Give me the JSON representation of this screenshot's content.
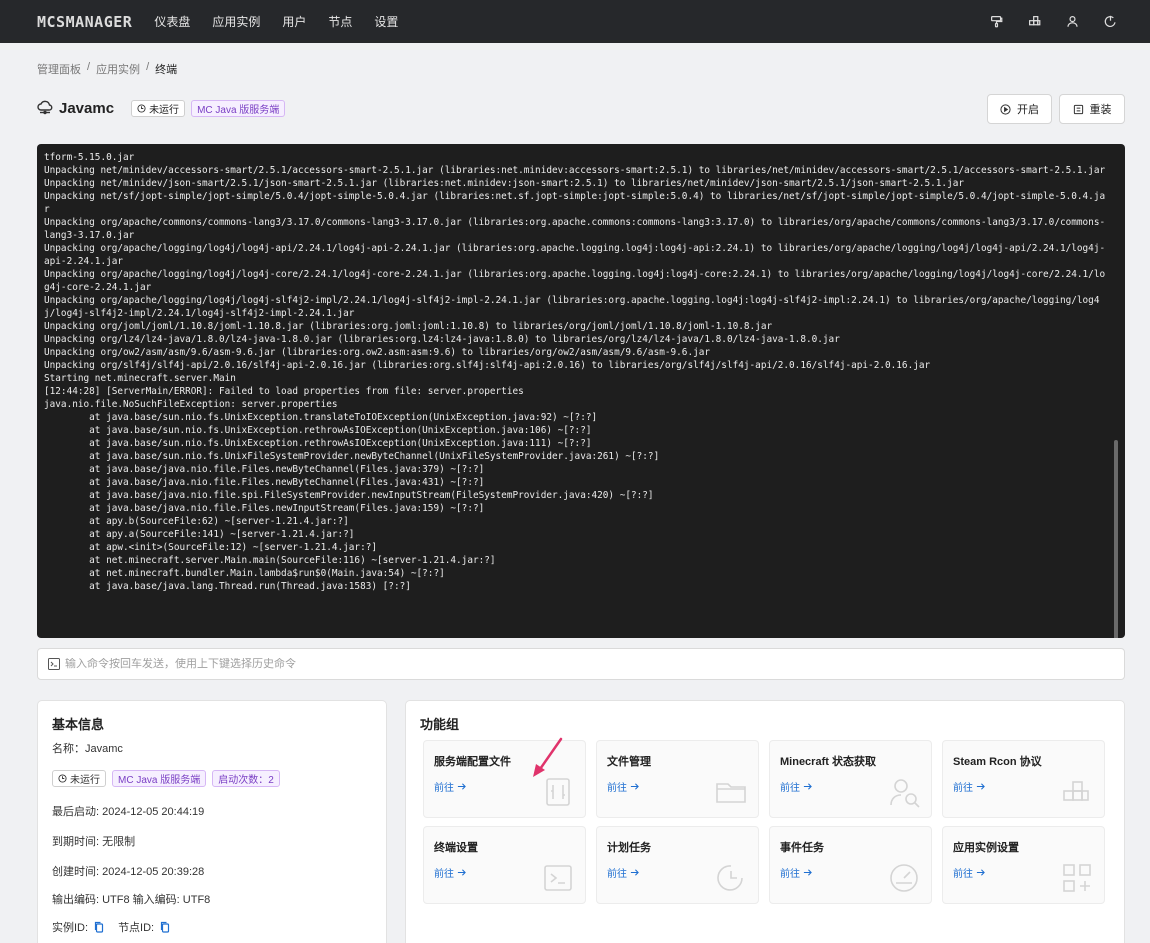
{
  "nav": {
    "logo": "MCSMANAGER",
    "items": [
      "仪表盘",
      "应用实例",
      "用户",
      "节点",
      "设置"
    ],
    "icons": [
      "paint-icon",
      "cube-icon",
      "user-icon",
      "logout-icon"
    ]
  },
  "breadcrumb": [
    "管理面板",
    "应用实例",
    "终端"
  ],
  "instance": {
    "title": "Javamc",
    "status": "未运行",
    "type": "MC Java 版服务端",
    "start_label": "开启",
    "reinstall_label": "重装"
  },
  "terminal": {
    "lines": [
      "tform-5.15.0.jar",
      "Unpacking net/minidev/accessors-smart/2.5.1/accessors-smart-2.5.1.jar (libraries:net.minidev:accessors-smart:2.5.1) to libraries/net/minidev/accessors-smart/2.5.1/accessors-smart-2.5.1.jar",
      "Unpacking net/minidev/json-smart/2.5.1/json-smart-2.5.1.jar (libraries:net.minidev:json-smart:2.5.1) to libraries/net/minidev/json-smart/2.5.1/json-smart-2.5.1.jar",
      "Unpacking net/sf/jopt-simple/jopt-simple/5.0.4/jopt-simple-5.0.4.jar (libraries:net.sf.jopt-simple:jopt-simple:5.0.4) to libraries/net/sf/jopt-simple/jopt-simple/5.0.4/jopt-simple-5.0.4.jar",
      "Unpacking org/apache/commons/commons-lang3/3.17.0/commons-lang3-3.17.0.jar (libraries:org.apache.commons:commons-lang3:3.17.0) to libraries/org/apache/commons/commons-lang3/3.17.0/commons-lang3-3.17.0.jar",
      "Unpacking org/apache/logging/log4j/log4j-api/2.24.1/log4j-api-2.24.1.jar (libraries:org.apache.logging.log4j:log4j-api:2.24.1) to libraries/org/apache/logging/log4j/log4j-api/2.24.1/log4j-api-2.24.1.jar",
      "Unpacking org/apache/logging/log4j/log4j-core/2.24.1/log4j-core-2.24.1.jar (libraries:org.apache.logging.log4j:log4j-core:2.24.1) to libraries/org/apache/logging/log4j/log4j-core/2.24.1/log4j-core-2.24.1.jar",
      "Unpacking org/apache/logging/log4j/log4j-slf4j2-impl/2.24.1/log4j-slf4j2-impl-2.24.1.jar (libraries:org.apache.logging.log4j:log4j-slf4j2-impl:2.24.1) to libraries/org/apache/logging/log4j/log4j-slf4j2-impl/2.24.1/log4j-slf4j2-impl-2.24.1.jar",
      "Unpacking org/joml/joml/1.10.8/joml-1.10.8.jar (libraries:org.joml:joml:1.10.8) to libraries/org/joml/joml/1.10.8/joml-1.10.8.jar",
      "Unpacking org/lz4/lz4-java/1.8.0/lz4-java-1.8.0.jar (libraries:org.lz4:lz4-java:1.8.0) to libraries/org/lz4/lz4-java/1.8.0/lz4-java-1.8.0.jar",
      "Unpacking org/ow2/asm/asm/9.6/asm-9.6.jar (libraries:org.ow2.asm:asm:9.6) to libraries/org/ow2/asm/asm/9.6/asm-9.6.jar",
      "Unpacking org/slf4j/slf4j-api/2.0.16/slf4j-api-2.0.16.jar (libraries:org.slf4j:slf4j-api:2.0.16) to libraries/org/slf4j/slf4j-api/2.0.16/slf4j-api-2.0.16.jar",
      "Starting net.minecraft.server.Main",
      "[12:44:28] [ServerMain/ERROR]: Failed to load properties from file: server.properties",
      "java.nio.file.NoSuchFileException: server.properties",
      "        at java.base/sun.nio.fs.UnixException.translateToIOException(UnixException.java:92) ~[?:?]",
      "        at java.base/sun.nio.fs.UnixException.rethrowAsIOException(UnixException.java:106) ~[?:?]",
      "        at java.base/sun.nio.fs.UnixException.rethrowAsIOException(UnixException.java:111) ~[?:?]",
      "        at java.base/sun.nio.fs.UnixFileSystemProvider.newByteChannel(UnixFileSystemProvider.java:261) ~[?:?]",
      "        at java.base/java.nio.file.Files.newByteChannel(Files.java:379) ~[?:?]",
      "        at java.base/java.nio.file.Files.newByteChannel(Files.java:431) ~[?:?]",
      "        at java.base/java.nio.file.spi.FileSystemProvider.newInputStream(FileSystemProvider.java:420) ~[?:?]",
      "        at java.base/java.nio.file.Files.newInputStream(Files.java:159) ~[?:?]",
      "        at apy.b(SourceFile:62) ~[server-1.21.4.jar:?]",
      "        at apy.a(SourceFile:141) ~[server-1.21.4.jar:?]",
      "        at apw.<init>(SourceFile:12) ~[server-1.21.4.jar:?]",
      "        at net.minecraft.server.Main.main(SourceFile:116) ~[server-1.21.4.jar:?]",
      "        at net.minecraft.bundler.Main.lambda$run$0(Main.java:54) ~[?:?]",
      "        at java.base/java.lang.Thread.run(Thread.java:1583) [?:?]"
    ]
  },
  "command": {
    "placeholder": "输入命令按回车发送，使用上下键选择历史命令"
  },
  "basic_info": {
    "title": "基本信息",
    "name": "名称：Javamc",
    "status": "未运行",
    "type": "MC Java 版服务端",
    "start_count": "启动次数：2",
    "last_start": "最后启动:    2024-12-05 20:44:19",
    "expire": "到期时间:    无限制",
    "created": "创建时间:    2024-12-05 20:39:28",
    "encoding": "输出编码:  UTF8  输入编码:  UTF8",
    "instance_id": "实例ID:",
    "node_id": "节点ID:"
  },
  "functions": {
    "title": "功能组",
    "go_label": "前往",
    "items": [
      {
        "title": "服务端配置文件",
        "icon": "settings-file-icon"
      },
      {
        "title": "文件管理",
        "icon": "folder-icon"
      },
      {
        "title": "Minecraft 状态获取",
        "icon": "user-search-icon"
      },
      {
        "title": "Steam Rcon 协议",
        "icon": "blocks-icon"
      },
      {
        "title": "终端设置",
        "icon": "terminal-icon"
      },
      {
        "title": "计划任务",
        "icon": "clock-icon"
      },
      {
        "title": "事件任务",
        "icon": "gauge-icon"
      },
      {
        "title": "应用实例设置",
        "icon": "apps-icon"
      }
    ]
  },
  "colors": {
    "topbar": "#26282b",
    "terminal_bg": "#1e1e1e",
    "link": "#1f6fd1",
    "tag_purple": "#7a3fc4",
    "arrow": "#e0336b"
  }
}
